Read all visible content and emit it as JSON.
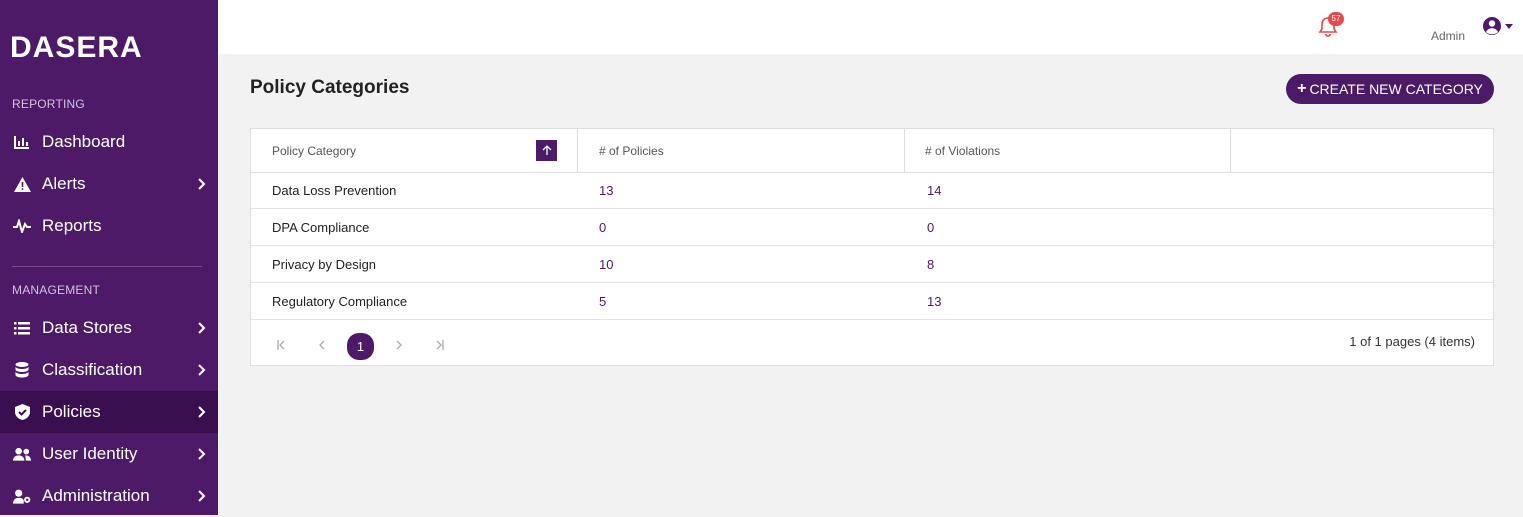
{
  "brand": {
    "name": "DASERA"
  },
  "sidebar": {
    "sections": [
      {
        "label": "REPORTING"
      },
      {
        "label": "MANAGEMENT"
      }
    ],
    "items": [
      {
        "label": "Dashboard",
        "icon": "chart-bar-icon"
      },
      {
        "label": "Alerts",
        "icon": "warning-icon"
      },
      {
        "label": "Reports",
        "icon": "pulse-icon"
      },
      {
        "label": "Data Stores",
        "icon": "list-icon"
      },
      {
        "label": "Classification",
        "icon": "database-icon"
      },
      {
        "label": "Policies",
        "icon": "shield-check-icon",
        "active": true
      },
      {
        "label": "User Identity",
        "icon": "users-icon"
      },
      {
        "label": "Administration",
        "icon": "user-cog-icon"
      }
    ]
  },
  "header": {
    "notifications_count": "57",
    "user_label": "Admin"
  },
  "page": {
    "title": "Policy Categories",
    "create_button": "CREATE NEW CATEGORY"
  },
  "table": {
    "columns": [
      "Policy Category",
      "# of Policies",
      "# of Violations"
    ],
    "rows": [
      {
        "category": "Data Loss Prevention",
        "policies": "13",
        "violations": "14"
      },
      {
        "category": "DPA Compliance",
        "policies": "0",
        "violations": "0"
      },
      {
        "category": "Privacy by Design",
        "policies": "10",
        "violations": "8"
      },
      {
        "category": "Regulatory Compliance",
        "policies": "5",
        "violations": "13"
      }
    ],
    "pagination": {
      "current_page": "1",
      "info": "1 of 1 pages (4 items)"
    }
  },
  "colors": {
    "brand": "#4d1a67",
    "brand_dark": "#3a0f4f",
    "badge": "#e5484d",
    "bell": "#e5484d"
  }
}
